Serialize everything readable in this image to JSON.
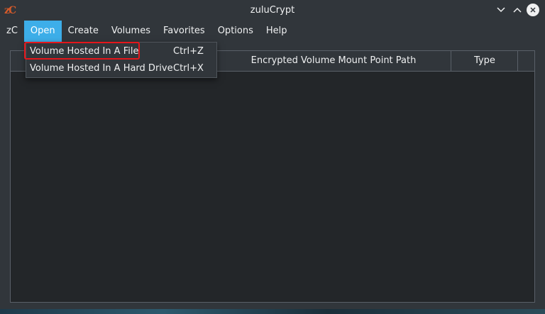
{
  "window": {
    "title": "zuluCrypt",
    "app_icon_text": "zC"
  },
  "menubar": {
    "items": [
      {
        "label": "zC"
      },
      {
        "label": "Open"
      },
      {
        "label": "Create"
      },
      {
        "label": "Volumes"
      },
      {
        "label": "Favorites"
      },
      {
        "label": "Options"
      },
      {
        "label": "Help"
      }
    ],
    "active": "Open"
  },
  "dropdown": {
    "items": [
      {
        "label": "Volume Hosted In A File",
        "shortcut": "Ctrl+Z"
      },
      {
        "label": "Volume Hosted In A Hard Drive",
        "shortcut": "Ctrl+X"
      }
    ]
  },
  "table": {
    "columns": [
      {
        "label": "Encrypted Volume Mount Point Path"
      },
      {
        "label": "Type"
      }
    ]
  },
  "colors": {
    "accent": "#3daee9",
    "window_bg": "#31363b",
    "table_bg": "#232629",
    "highlight_outline": "#e5161b"
  },
  "icons": {
    "minimize": "chevron-down-icon",
    "maximize": "chevron-up-icon",
    "close": "close-icon"
  }
}
